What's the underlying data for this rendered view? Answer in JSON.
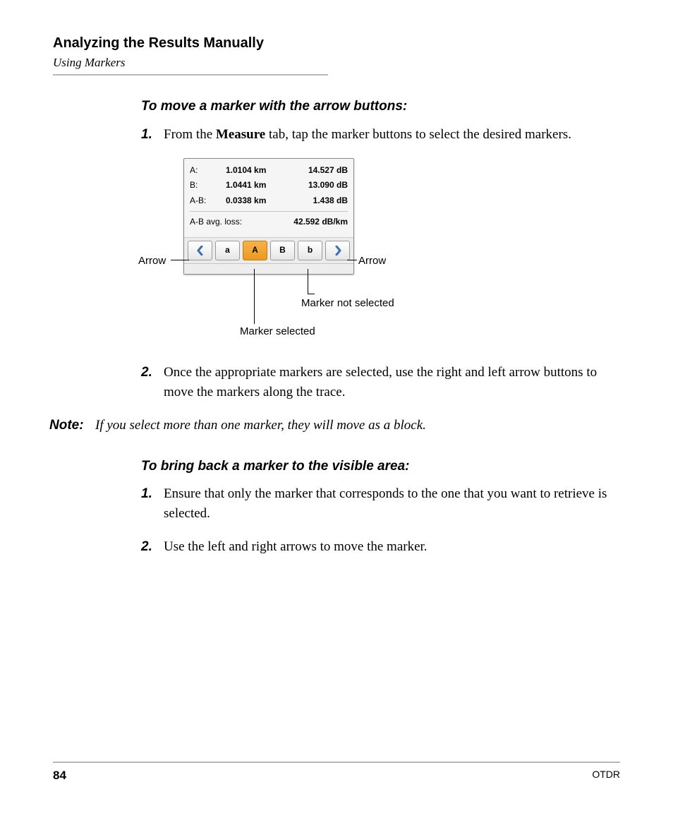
{
  "header": {
    "title": "Analyzing the Results Manually",
    "subtitle": "Using Markers"
  },
  "section1": {
    "heading": "To move a marker with the arrow buttons:",
    "step1_num": "1.",
    "step1_a": "From the ",
    "step1_bold": "Measure",
    "step1_b": " tab, tap the marker buttons to select the desired markers.",
    "step2_num": "2.",
    "step2": "Once the appropriate markers are selected, use the right and left arrow buttons to move the markers along the trace."
  },
  "note": {
    "label": "Note:",
    "text": "If you select more than one marker, they will move as a block."
  },
  "section2": {
    "heading": "To bring back a marker to the visible area:",
    "step1_num": "1.",
    "step1": "Ensure that only the marker that corresponds to the one that you want to retrieve is selected.",
    "step2_num": "2.",
    "step2": "Use the left and right arrows to move the marker."
  },
  "panel": {
    "rows": [
      {
        "lbl": "A:",
        "dist": "1.0104 km",
        "loss": "14.527 dB"
      },
      {
        "lbl": "B:",
        "dist": "1.0441 km",
        "loss": "13.090 dB"
      },
      {
        "lbl": "A-B:",
        "dist": "0.0338 km",
        "loss": "1.438 dB"
      }
    ],
    "avg_label": "A-B avg. loss:",
    "avg_value": "42.592 dB/km",
    "buttons": {
      "a_small": "a",
      "A_big": "A",
      "B_big": "B",
      "b_small": "b"
    }
  },
  "callouts": {
    "arrow_left": "Arrow",
    "arrow_right": "Arrow",
    "marker_selected": "Marker selected",
    "marker_not_selected": "Marker not selected"
  },
  "footer": {
    "page": "84",
    "product": "OTDR"
  }
}
